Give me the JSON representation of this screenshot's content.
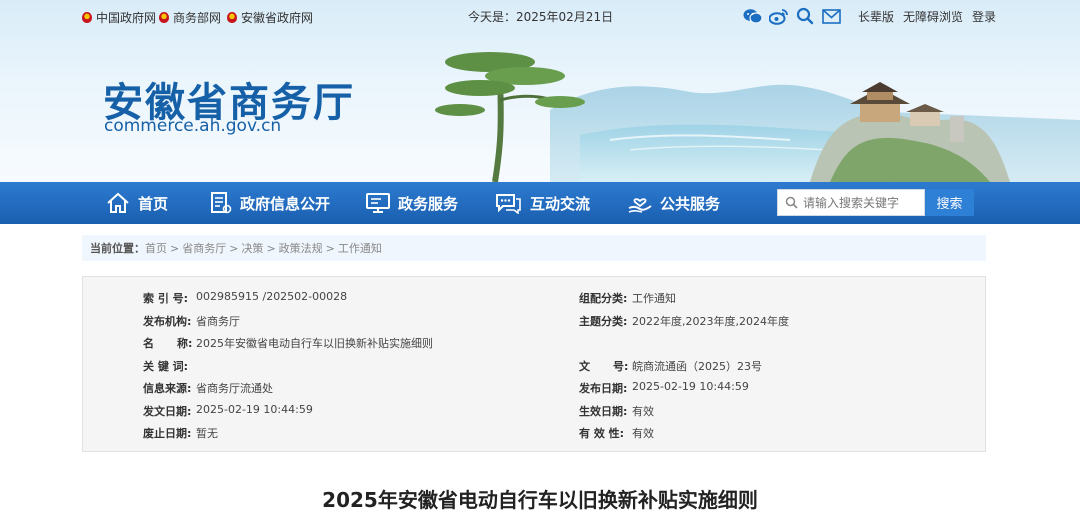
{
  "topbar": {
    "links": [
      "中国政府网",
      "商务部网",
      "安徽省政府网"
    ],
    "today": "今天是：2025年02月21日",
    "icons": [
      "wechat-icon",
      "weibo-icon",
      "search-icon",
      "mail-icon"
    ],
    "right_links": [
      "长辈版",
      "无障碍浏览",
      "登录"
    ]
  },
  "logo": {
    "name": "安徽省商务厅",
    "domain": "commerce.ah.gov.cn"
  },
  "nav": {
    "items": [
      {
        "label": "首页",
        "icon": "home-icon"
      },
      {
        "label": "政府信息公开",
        "icon": "document-icon"
      },
      {
        "label": "政务服务",
        "icon": "monitor-icon"
      },
      {
        "label": "互动交流",
        "icon": "chat-icon"
      },
      {
        "label": "公共服务",
        "icon": "hand-heart-icon"
      }
    ],
    "search_placeholder": "请输入搜索关键字",
    "search_button": "搜索"
  },
  "breadcrumb": {
    "label": "当前位置：",
    "items": [
      "首页",
      "省商务厅",
      "决策",
      "政策法规",
      "工作通知"
    ],
    "separator": ">"
  },
  "info": {
    "left": [
      {
        "key": "索 引 号:",
        "value": "002985915 /202502-00028"
      },
      {
        "key": "发布机构:",
        "value": "省商务厅"
      },
      {
        "key": "名      称:",
        "value": "2025年安徽省电动自行车以旧换新补贴实施细则"
      },
      {
        "key": "关 键 词:",
        "value": ""
      },
      {
        "key": "信息来源:",
        "value": "省商务厅流通处"
      },
      {
        "key": "发文日期:",
        "value": "2025-02-19 10:44:59"
      },
      {
        "key": "废止日期:",
        "value": "暂无"
      }
    ],
    "right": [
      {
        "key": "组配分类:",
        "value": "工作通知"
      },
      {
        "key": "主题分类:",
        "value": "2022年度,2023年度,2024年度"
      },
      {
        "key": "",
        "value": ""
      },
      {
        "key": "文      号:",
        "value": "皖商流通函（2025）23号"
      },
      {
        "key": "发布日期:",
        "value": "2025-02-19 10:44:59"
      },
      {
        "key": "生效日期:",
        "value": "有效"
      },
      {
        "key": "有 效 性:",
        "value": "有效"
      }
    ]
  },
  "document": {
    "title": "2025年安徽省电动自行车以旧换新补贴实施细则"
  },
  "colors": {
    "brand_blue": "#1660a8",
    "nav_blue": "#1a5fb0",
    "button_blue": "#2e7fd6"
  }
}
